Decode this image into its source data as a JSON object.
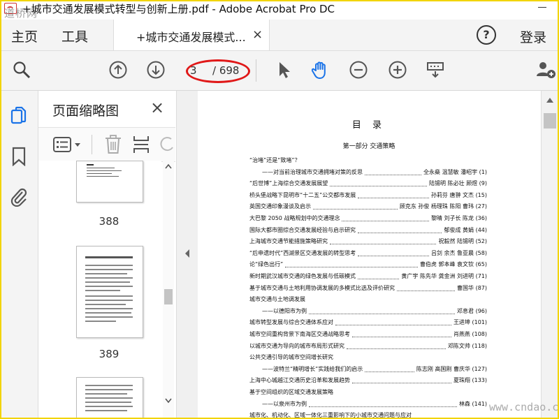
{
  "window": {
    "title": "+城市交通发展模式转型与创新上册.pdf - Adobe Acrobat Pro DC",
    "watermark_top_left": "道桥网",
    "watermark_bottom_right": "www.cndao.com"
  },
  "menu": {
    "home": "主页",
    "tools": "工具",
    "tab_label": "+城市交通发展模式...",
    "tab_close": "×",
    "help": "?",
    "login": "登录"
  },
  "toolbar": {
    "page_current": "3",
    "page_total": "/ 698",
    "icons": [
      "search-icon",
      "page-up-icon",
      "page-down-icon",
      "select-arrow-icon",
      "hand-icon",
      "zoom-out-icon",
      "zoom-in-icon",
      "keyboard-icon",
      "add-user-icon"
    ]
  },
  "panel": {
    "title": "页面缩略图",
    "close": "×",
    "thumbs": [
      {
        "number": "388"
      },
      {
        "number": "389"
      }
    ]
  },
  "document": {
    "heading": "目 录",
    "part": "第一部分 交通策略",
    "toc": [
      {
        "title": "“治堵”还是“致堵”？",
        "author": "",
        "page": ""
      },
      {
        "title": "——对当前治理城市交通拥堵对策的反思",
        "author": "全永燊 温慧敏 潘昭宇",
        "page": "(1)",
        "indent": true
      },
      {
        "title": "“后世博”上海综合交通发展展望",
        "author": "陆锡明 陈必壮 顾煜",
        "page": "(9)"
      },
      {
        "title": "桥头堡战略下昆明市“十二五”公交都市发展",
        "author": "孙莉芬 唐翀 文杰",
        "page": "(15)"
      },
      {
        "title": "英国交通印象漫谈及启示",
        "author": "顾克东 孙俊 杨理珠 陈阳 曹玮",
        "page": "(27)"
      },
      {
        "title": "大巴黎 2050 战略规划中的交通理念",
        "author": "黎晴 刘子长 陈龙",
        "page": "(36)"
      },
      {
        "title": "国际大都市圈综合交通发展经验与启示研究",
        "author": "郁俊成 黄娟",
        "page": "(44)"
      },
      {
        "title": "上海城市交通节能措施策略研究",
        "author": "祝毅然 陆锡明",
        "page": "(52)"
      },
      {
        "title": "“后申遗时代”西湖景区交通发展的转型思考",
        "author": "吕剑 余杰 鲁亚晨",
        "page": "(58)"
      },
      {
        "title": "论“绿色出行”",
        "author": "曹伯虎 郭本峰 袁文钦",
        "page": "(65)"
      },
      {
        "title": "新时期武汉城市交通的绿色发展与低碳模式",
        "author": "黄广宇 陈先华 龚金洲 刘进明",
        "page": "(71)"
      },
      {
        "title": "基于城市交通与土地利用协调发展的多模式比选及评价研究",
        "author": "曹国华",
        "page": "(87)"
      },
      {
        "title": "城市交通与土地调发展",
        "author": "",
        "page": ""
      },
      {
        "title": "——以德阳市为例",
        "author": "邓息君",
        "page": "(96)",
        "indent": true
      },
      {
        "title": "城市转型发展与综合交通体系应对",
        "author": "王进坤",
        "page": "(101)"
      },
      {
        "title": "城市空间重构背景下南海区交通战略思考",
        "author": "肖燕燕",
        "page": "(108)"
      },
      {
        "title": "以城市交通为导向的城市布局形式研究",
        "author": "邓陈文帅",
        "page": "(118)"
      },
      {
        "title": "公共交通引导的城市空间增长研究",
        "author": "",
        "page": ""
      },
      {
        "title": "——波特兰“精明增长”实践给我们的启示",
        "author": "陈志刚 高国刚 曹庆华",
        "page": "(127)",
        "indent": true
      },
      {
        "title": "上海中心城越江交通历史沿革和发展趋势",
        "author": "夏珠翔",
        "page": "(133)"
      },
      {
        "title": "基于空间组织的区域交通发展策略",
        "author": "",
        "page": ""
      },
      {
        "title": "——以泉州市为例",
        "author": "林森",
        "page": "(141)",
        "indent": true
      },
      {
        "title": "城市化、机动化、区域一体化三重影响下的小城市交通问题与应对",
        "author": "",
        "page": ""
      }
    ]
  }
}
